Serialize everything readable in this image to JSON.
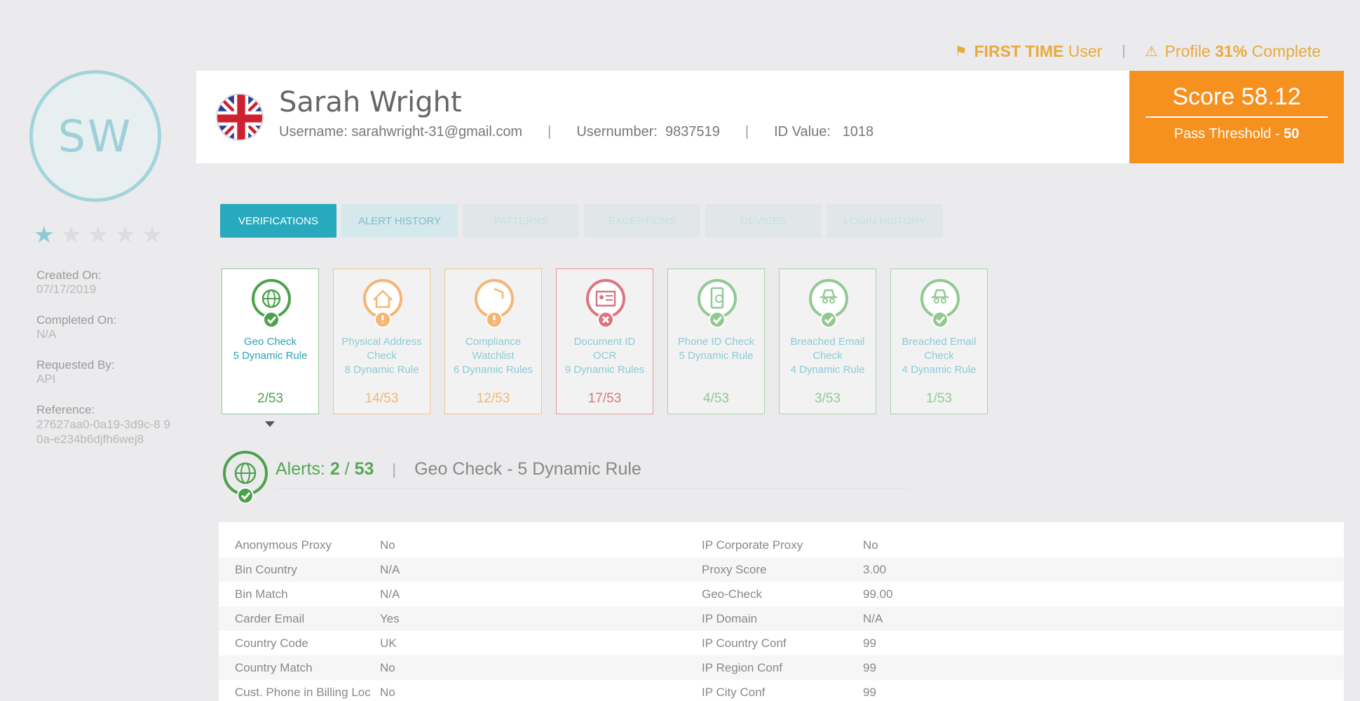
{
  "profile": {
    "initials": "SW",
    "rating": 1,
    "created_label": "Created On:",
    "created_value": "07/17/2019",
    "completed_label": "Completed On:",
    "completed_value": "N/A",
    "requested_label": "Requested By:",
    "requested_value": "API",
    "reference_label": "Reference:",
    "reference_value": "27627aa0-0a19-3d9c-8 90a-e234b6djfh6wej8"
  },
  "top": {
    "first_time_bold": "FIRST TIME",
    "first_time_rest": "User",
    "profile_prefix": "Profile",
    "profile_percent": "31%",
    "profile_suffix": "Complete"
  },
  "header": {
    "name": "Sarah Wright",
    "username_label": "Username:",
    "username": "sarahwright-31@gmail.com",
    "usernumber_label": "Usernumber:",
    "usernumber": "9837519",
    "idvalue_label": "ID Value:",
    "idvalue": "1018",
    "flag_icon": "uk-flag-icon"
  },
  "score": {
    "label": "Score",
    "value": "58.12",
    "threshold_label": "Pass Threshold -",
    "threshold_value": "50",
    "color": "#f6901e"
  },
  "tabs": [
    "VERIFICATIONS",
    "ALERT HISTORY",
    "PATTERNS",
    "EXCEPTIONS",
    "DEVICES",
    "LOGIN HISTORY"
  ],
  "cards": [
    {
      "line1": "Geo Check",
      "line2": "5 Dynamic Rule",
      "line3": "",
      "count": "2/53",
      "status": "pass",
      "icon": "globe-icon",
      "color": "#4ca24c"
    },
    {
      "line1": "Physical Address",
      "line2": "Check",
      "line3": "8 Dynamic Rule",
      "count": "14/53",
      "status": "warn",
      "icon": "house-icon",
      "color": "#f5b574"
    },
    {
      "line1": "Compliance",
      "line2": "Watchlist",
      "line3": "6 Dynamic Rules",
      "count": "12/53",
      "status": "warn",
      "icon": "shield-icon",
      "color": "#f5b574"
    },
    {
      "line1": "Document ID",
      "line2": "OCR",
      "line3": "9 Dynamic Rules",
      "count": "17/53",
      "status": "fail",
      "icon": "id-document-icon",
      "color": "#dc7580"
    },
    {
      "line1": "Phone ID Check",
      "line2": "5 Dynamic Rule",
      "line3": "",
      "count": "4/53",
      "status": "pass",
      "icon": "phone-icon",
      "color": "#92c992"
    },
    {
      "line1": "Breached Email",
      "line2": "Check",
      "line3": "4 Dynamic Rule",
      "count": "3/53",
      "status": "pass",
      "icon": "spy-icon",
      "color": "#92c992"
    },
    {
      "line1": "Breached Email",
      "line2": "Check",
      "line3": "4 Dynamic Rule",
      "count": "1/53",
      "status": "pass",
      "icon": "spy-icon",
      "color": "#92c992"
    }
  ],
  "alerts": {
    "label": "Alerts:",
    "count": "2",
    "slash": "/",
    "total": "53",
    "rule": "Geo Check - 5 Dynamic Rule"
  },
  "details": [
    {
      "k1": "Anonymous Proxy",
      "v1": "No",
      "k2": "IP Corporate Proxy",
      "v2": "No"
    },
    {
      "k1": "Bin Country",
      "v1": "N/A",
      "k2": "Proxy Score",
      "v2": "3.00"
    },
    {
      "k1": "Bin Match",
      "v1": "N/A",
      "k2": "Geo-Check",
      "v2": "99.00"
    },
    {
      "k1": "Carder Email",
      "v1": "Yes",
      "k2": "IP Domain",
      "v2": "N/A"
    },
    {
      "k1": "Country Code",
      "v1": "UK",
      "k2": "IP Country Conf",
      "v2": "99"
    },
    {
      "k1": "Country Match",
      "v1": "No",
      "k2": "IP Region Conf",
      "v2": "99"
    },
    {
      "k1": "Cust. Phone in Billing Loc",
      "v1": "No",
      "k2": "IP City Conf",
      "v2": "99"
    }
  ]
}
